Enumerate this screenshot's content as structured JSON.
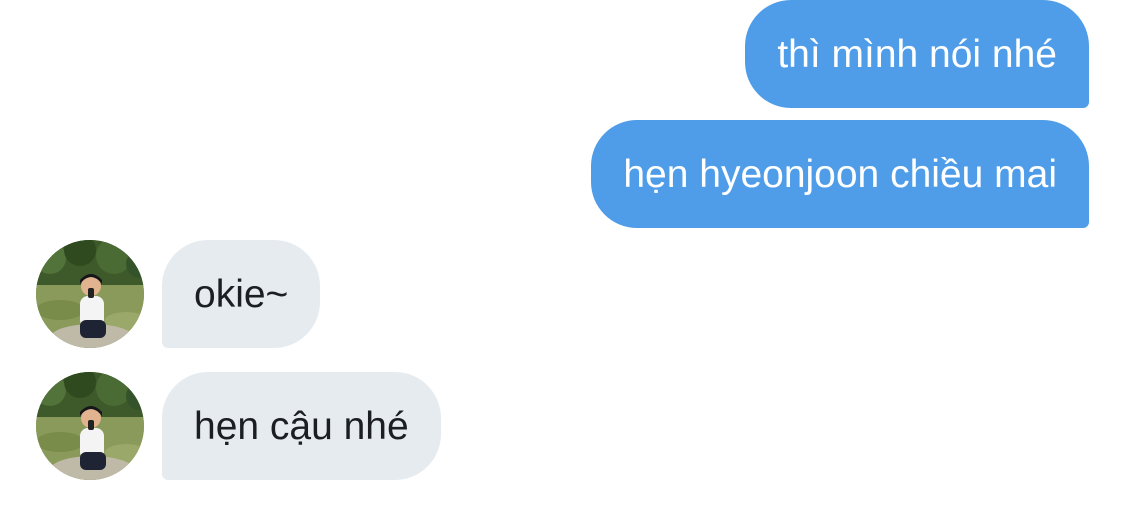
{
  "conversation": {
    "messages": [
      {
        "direction": "sent",
        "text": "thì mình nói nhé"
      },
      {
        "direction": "sent",
        "text": "hẹn hyeonjoon chiều mai"
      },
      {
        "direction": "received",
        "text": "okie~"
      },
      {
        "direction": "received",
        "text": "hẹn cậu nhé"
      }
    ]
  },
  "colors": {
    "sent_bubble": "#4f9de9",
    "sent_text": "#ffffff",
    "received_bubble": "#e6ebf0",
    "received_text": "#1b1f24"
  },
  "icons": {
    "avatar": "contact-avatar-photo"
  }
}
